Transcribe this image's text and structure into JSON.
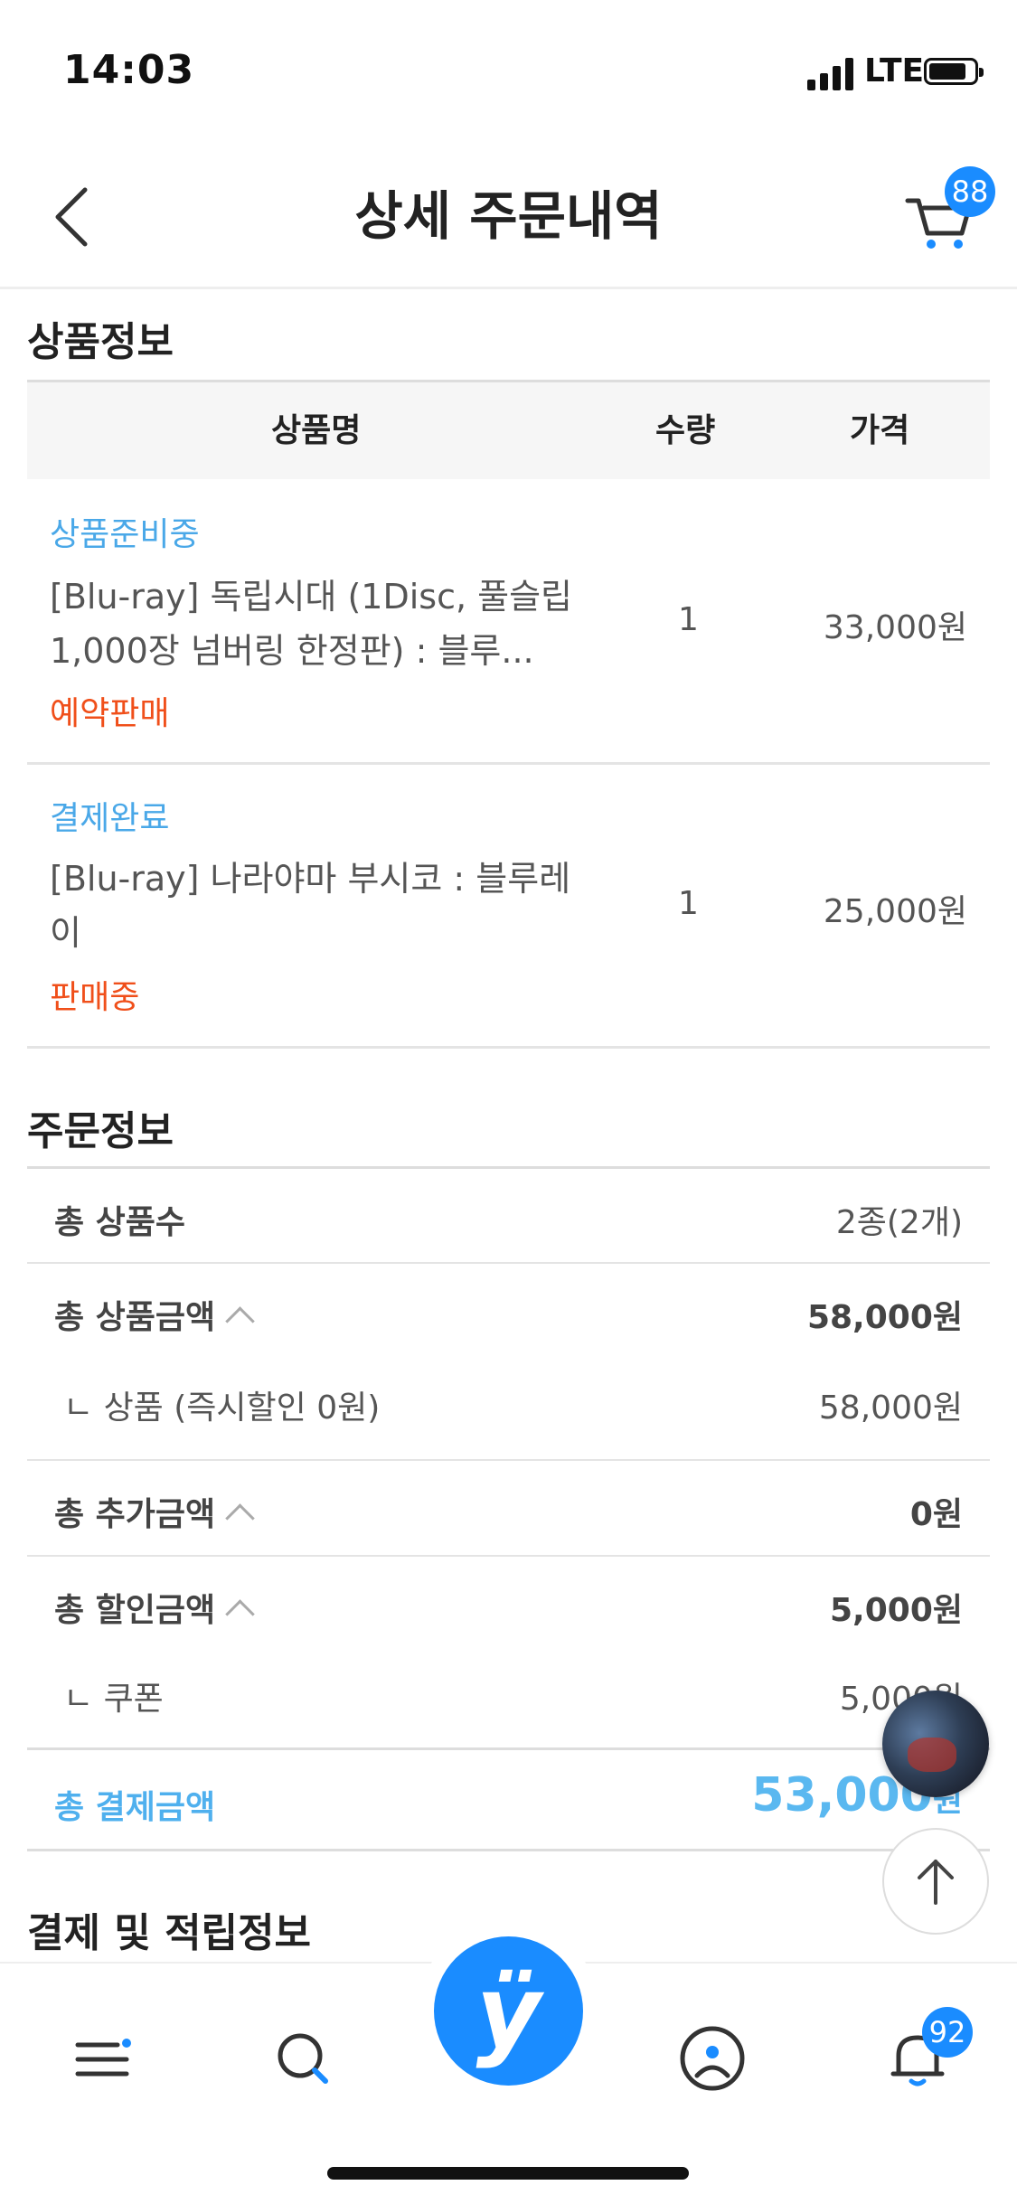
{
  "status_bar": {
    "time": "14:03",
    "network": "LTE"
  },
  "header": {
    "title": "상세 주문내역",
    "cart_count": "88"
  },
  "product_section": {
    "title": "상품정보",
    "columns": {
      "name": "상품명",
      "qty": "수량",
      "price": "가격"
    },
    "items": [
      {
        "status": "상품준비중",
        "name": "[Blu-ray] 독립시대 (1Disc, 풀슬립 1,000장 넘버링 한정판) : 블루...",
        "tag": "예약판매",
        "qty": "1",
        "price": "33,000원"
      },
      {
        "status": "결제완료",
        "name": "[Blu-ray] 나라야마 부시코 : 블루레이",
        "tag": "판매중",
        "qty": "1",
        "price": "25,000원"
      }
    ]
  },
  "order_section": {
    "title": "주문정보",
    "total_items": {
      "label": "총 상품수",
      "value": "2종(2개)"
    },
    "total_product_amount": {
      "label": "총 상품금액",
      "value": "58,000원"
    },
    "product_sub": {
      "label": "ㄴ 상품 (즉시할인 0원)",
      "value": "58,000원"
    },
    "total_extra": {
      "label": "총 추가금액",
      "value": "0원"
    },
    "total_discount": {
      "label": "총 할인금액",
      "value": "5,000원"
    },
    "coupon_sub": {
      "label": "ㄴ 쿠폰",
      "value": "5,000원"
    },
    "total_payment": {
      "label": "총 결제금액",
      "value": "53,000",
      "unit": "원"
    }
  },
  "payment_section": {
    "title": "결제 및 적립정보"
  },
  "tabbar": {
    "center_logo": "ÿ",
    "notification_count": "92"
  },
  "colors": {
    "accent": "#1a8cff",
    "status_blue": "#4aa8e8",
    "tag_orange": "#f04f1a"
  }
}
